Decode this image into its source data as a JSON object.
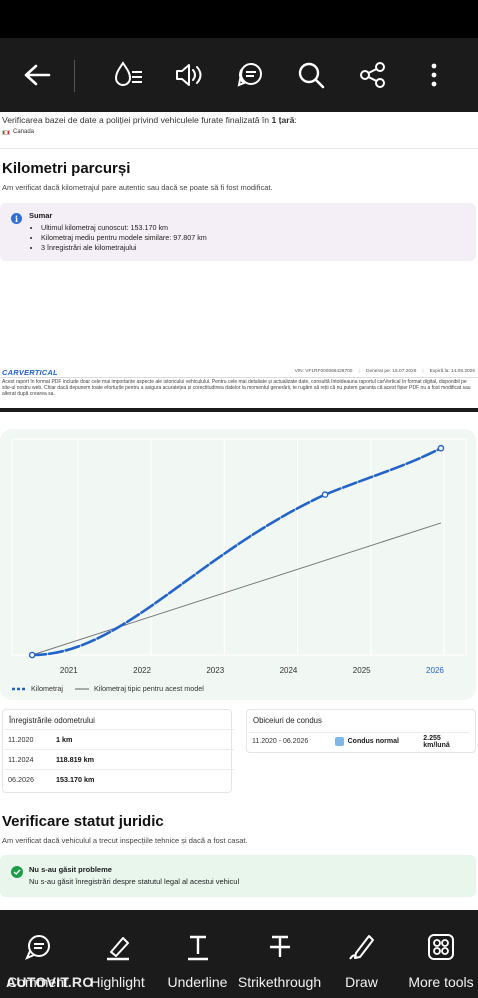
{
  "toolbar": {
    "back_icon": "back-arrow-icon",
    "icons": [
      "reading-mode-icon",
      "read-aloud-icon",
      "comments-icon",
      "search-icon",
      "share-icon",
      "more-options-icon"
    ]
  },
  "page1": {
    "verification_text": "Verificarea bazei de date a poliției privind vehiculele furate finalizată în ",
    "verification_bold": "1 țară",
    "verification_end": ":",
    "country": "Canada",
    "mileage": {
      "heading": "Kilometri parcurși",
      "subtitle": "Am verificat dacă kilometrajul pare autentic sau dacă se poate să fi fost modificat.",
      "summary_title": "Sumar",
      "summary_items": [
        "Ultimul kilometraj cunoscut: 153.170 km",
        "Kilometraj mediu pentru modele similare: 97.807 km",
        "3 înregistrări ale kilometrajului"
      ]
    },
    "footer": {
      "brand": "CARVERTICAL",
      "vin": "VIN: VF1RF000066428700",
      "generated": "Generat pe: 15.07.2026",
      "expires": "Expiră la: 14.08.2026",
      "disclaimer": "Acest raport în format PDF include doar cele mai importante aspecte ale istoricului vehiculului. Pentru cele mai detaliate și actualizate date, consultă întotdeauna raportul carVertical în format digital, disponibil pe site-ul nostru web. Chiar dacă depunem toate eforturile pentru a asigura acuratețea și corectitudinea datelor la momentul generării, te rugăm să reții că nu putem garanta că acest fișier PDF nu a fost modificat sau alterat după crearea sa."
    }
  },
  "page2": {
    "chart_data": {
      "type": "line",
      "x_ticks": [
        "2021",
        "2022",
        "2023",
        "2024",
        "2025",
        "2026"
      ],
      "highlighted_tick": "2026",
      "series": [
        {
          "name": "Kilometraj",
          "style": "dashed-dotted",
          "color": "#2364c9",
          "points": [
            [
              "2020-11",
              1
            ],
            [
              "2024-11",
              118819
            ],
            [
              "2026-06",
              153170
            ]
          ]
        },
        {
          "name": "Kilometraj tipic pentru acest model",
          "style": "solid",
          "color": "#777777",
          "points": [
            [
              "2020-11",
              1
            ],
            [
              "2026-06",
              97807
            ]
          ]
        }
      ],
      "y_axis_labels_visible": false,
      "grid": "vertical",
      "legend": "bottom-left"
    },
    "odometer": {
      "title": "Înregistrările odometrului",
      "rows": [
        {
          "date": "11.2020",
          "value": "1 km"
        },
        {
          "date": "11.2024",
          "value": "118.819 km"
        },
        {
          "date": "06.2026",
          "value": "153.170 km"
        }
      ]
    },
    "driving": {
      "title": "Obiceiuri de condus",
      "period": "11.2020 - 06.2026",
      "label": "Condus normal",
      "rate": "2.255 km/lună",
      "color": "#7fb7e8"
    },
    "legal": {
      "heading": "Verificare statut juridic",
      "subtitle": "Am verificat dacă vehiculul a trecut inspecțiile tehnice și dacă a fost casat.",
      "ok_title": "Nu s-au găsit probleme",
      "ok_text": "Nu s-au găsit înregistrări despre statutul legal al acestui vehicul"
    }
  },
  "bottom_toolbar": {
    "items": [
      {
        "label": "Comment",
        "icon": "comment-icon"
      },
      {
        "label": "Highlight",
        "icon": "highlight-icon"
      },
      {
        "label": "Underline",
        "icon": "underline-icon"
      },
      {
        "label": "Strikethrough",
        "icon": "strikethrough-icon"
      },
      {
        "label": "Draw",
        "icon": "draw-icon"
      },
      {
        "label": "More tools",
        "icon": "more-tools-icon"
      }
    ],
    "watermark": "AUTOVIT.RO"
  }
}
